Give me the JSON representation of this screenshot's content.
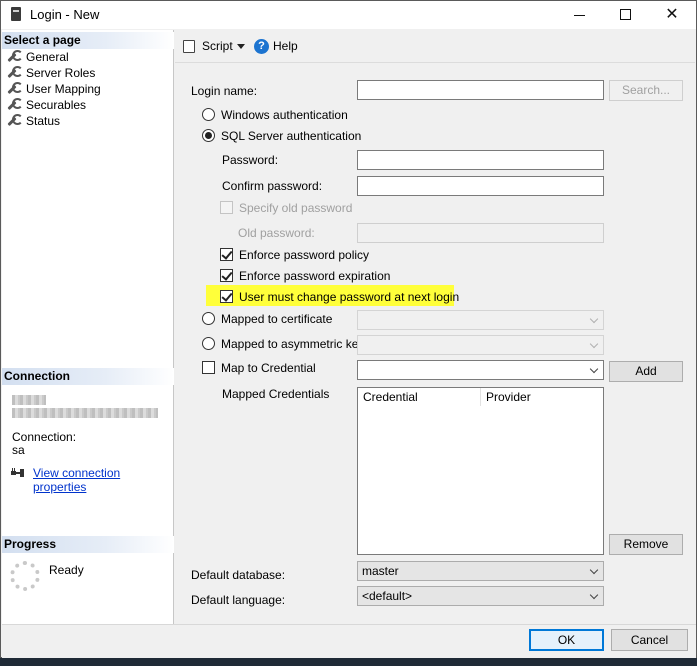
{
  "window": {
    "title": "Login - New"
  },
  "left": {
    "select_page_header": "Select a page",
    "pages": [
      "General",
      "Server Roles",
      "User Mapping",
      "Securables",
      "Status"
    ],
    "connection_header": "Connection",
    "connection_label": "Connection:",
    "connection_value": "sa",
    "view_connection_link": "View connection properties",
    "progress_header": "Progress",
    "progress_status": "Ready"
  },
  "toolbar": {
    "script_label": "Script",
    "help_label": "Help"
  },
  "form": {
    "login_name_label": "Login name:",
    "login_name_value": "",
    "search_button": "Search...",
    "windows_auth": "Windows authentication",
    "sql_auth": "SQL Server authentication",
    "password_label": "Password:",
    "confirm_password_label": "Confirm password:",
    "specify_old_password": "Specify old password",
    "old_password_label": "Old password:",
    "enforce_policy": "Enforce password policy",
    "enforce_expiration": "Enforce password expiration",
    "must_change": "User must change password at next login",
    "mapped_cert": "Mapped to certificate",
    "mapped_asym": "Mapped to asymmetric key",
    "map_credential": "Map to Credential",
    "add_button": "Add",
    "mapped_credentials_label": "Mapped Credentials",
    "credential_col": "Credential",
    "provider_col": "Provider",
    "remove_button": "Remove",
    "default_database_label": "Default database:",
    "default_database_value": "master",
    "default_language_label": "Default language:",
    "default_language_value": "<default>"
  },
  "footer": {
    "ok": "OK",
    "cancel": "Cancel"
  },
  "colors": {
    "highlight": "#ffff3a",
    "link": "#0033cc",
    "ok_border": "#0078d7"
  }
}
